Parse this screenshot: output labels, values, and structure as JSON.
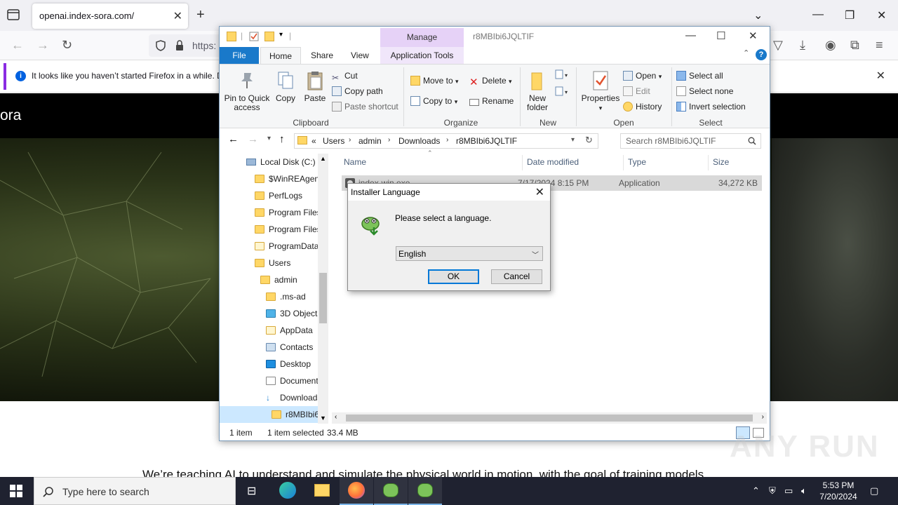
{
  "browser": {
    "tab_title": "openai.index-sora.com/",
    "url": "https:",
    "notice": "It looks like you haven’t started Firefox in a while. D"
  },
  "page": {
    "logo": "ora",
    "tagline": "We’re teaching AI to understand and simulate the physical world in motion, with the goal of training models"
  },
  "explorer": {
    "title": "r8MBIbi6JQLTIF",
    "manage": "Manage",
    "tabs": {
      "file": "File",
      "home": "Home",
      "share": "Share",
      "view": "View",
      "app_tools": "Application Tools"
    },
    "ribbon": {
      "pin": "Pin to Quick access",
      "copy": "Copy",
      "paste": "Paste",
      "cut": "Cut",
      "copy_path": "Copy path",
      "paste_shortcut": "Paste shortcut",
      "clipboard": "Clipboard",
      "move_to": "Move to",
      "copy_to": "Copy to",
      "delete": "Delete",
      "rename": "Rename",
      "organize": "Organize",
      "new_folder": "New folder",
      "new": "New",
      "properties": "Properties",
      "open": "Open",
      "edit": "Edit",
      "history": "History",
      "open_group": "Open",
      "select_all": "Select all",
      "select_none": "Select none",
      "invert_selection": "Invert selection",
      "select_group": "Select"
    },
    "address": {
      "prefix": "«",
      "crumbs": [
        "Users",
        "admin",
        "Downloads",
        "r8MBIbi6JQLTIF"
      ]
    },
    "search_placeholder": "Search r8MBIbi6JQLTIF",
    "nav_items": [
      "Local Disk (C:)",
      "$WinREAgent",
      "PerfLogs",
      "Program Files",
      "Program Files",
      "ProgramData",
      "Users",
      "admin",
      ".ms-ad",
      "3D Objects",
      "AppData",
      "Contacts",
      "Desktop",
      "Documents",
      "Downloads",
      "r8MBIbi6"
    ],
    "columns": {
      "name": "Name",
      "date": "Date modified",
      "type": "Type",
      "size": "Size"
    },
    "file": {
      "name": "index-win.exe",
      "date": "7/17/2024 8:15 PM",
      "type": "Application",
      "size": "34,272 KB"
    },
    "status": {
      "count": "1 item",
      "selected": "1 item selected",
      "size": "33.4 MB"
    }
  },
  "dialog": {
    "title": "Installer Language",
    "message": "Please select a language.",
    "language": "English",
    "ok": "OK",
    "cancel": "Cancel"
  },
  "taskbar": {
    "search_placeholder": "Type here to search",
    "time": "5:53 PM",
    "date": "7/20/2024"
  },
  "watermark": "ANY RUN"
}
